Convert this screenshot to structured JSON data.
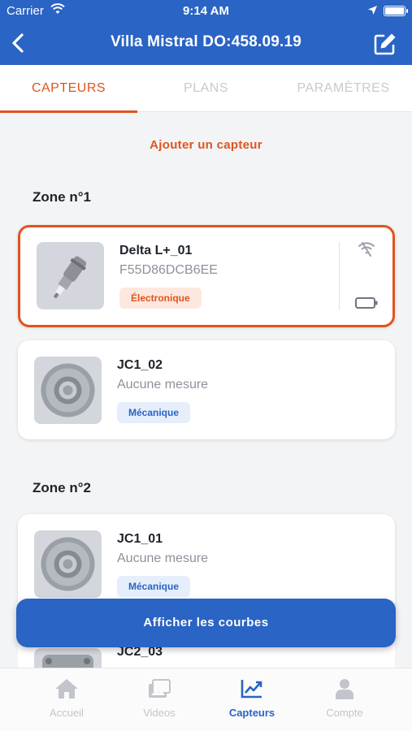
{
  "status_bar": {
    "carrier": "Carrier",
    "time": "9:14 AM"
  },
  "nav": {
    "title": "Villa Mistral DO:458.09.19"
  },
  "tabs": [
    {
      "label": "CAPTEURS",
      "active": true
    },
    {
      "label": "PLANS",
      "active": false
    },
    {
      "label": "PARAMÈTRES",
      "active": false
    }
  ],
  "add_sensor_label": "Ajouter un capteur",
  "zones": [
    {
      "title": "Zone n°1",
      "sensors": [
        {
          "name": "Delta L+_01",
          "subtitle": "F55D86DCB6EE",
          "type": "Électronique",
          "selected": true,
          "icon": "electronic-sensor"
        },
        {
          "name": "JC1_02",
          "subtitle": "Aucune mesure",
          "type": "Mécanique",
          "selected": false,
          "icon": "mechanical-sensor"
        }
      ]
    },
    {
      "title": "Zone n°2",
      "sensors": [
        {
          "name": "JC1_01",
          "subtitle": "Aucune mesure",
          "type": "Mécanique",
          "selected": false,
          "icon": "mechanical-sensor"
        },
        {
          "name": "JC2_03",
          "subtitle": "",
          "type": "",
          "selected": false,
          "icon": "mechanical-sensor"
        }
      ]
    }
  ],
  "fab_label": "Afficher les courbes",
  "bottom_tabs": [
    {
      "label": "Accueil",
      "icon": "home-icon",
      "active": false
    },
    {
      "label": "Videos",
      "icon": "videos-icon",
      "active": false
    },
    {
      "label": "Capteurs",
      "icon": "chart-icon",
      "active": true
    },
    {
      "label": "Compte",
      "icon": "person-icon",
      "active": false
    }
  ],
  "colors": {
    "primary": "#2a64c4",
    "accent": "#e0541e",
    "background": "#f3f4f6"
  }
}
